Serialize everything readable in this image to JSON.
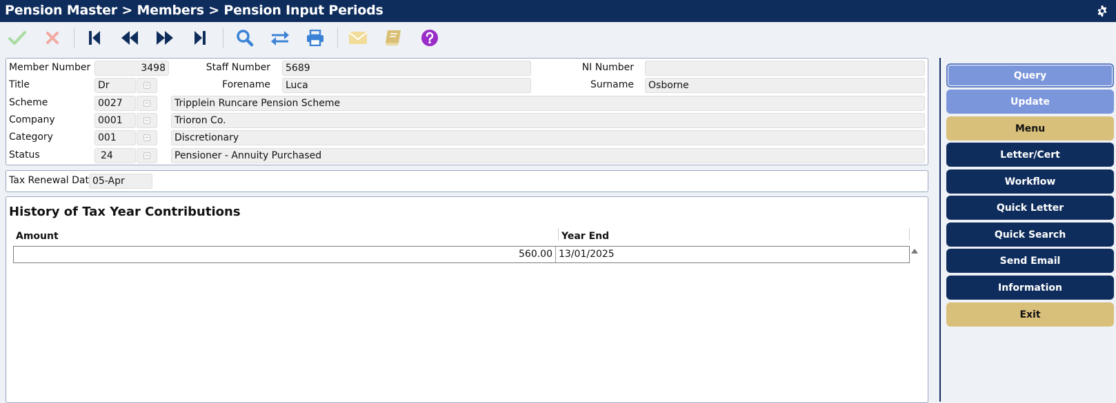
{
  "header": {
    "title": "Pension Master > Members > Pension Input Periods",
    "settings_icon": "gear-icon"
  },
  "toolbar": {
    "icons": {
      "accept": "check-icon",
      "cancel": "close-icon",
      "first": "first-record-icon",
      "previous": "previous-record-icon",
      "next": "next-record-icon",
      "last": "last-record-icon",
      "search": "search-icon",
      "swap": "swap-icon",
      "print": "print-icon",
      "email": "envelope-icon",
      "notes": "book-icon",
      "help": "help-icon"
    },
    "colors": {
      "accept": "#a8dba0",
      "cancel": "#f4a9a3",
      "nav": "#0f2d5c",
      "search": "#3b82d6",
      "email": "#f2dc9a",
      "notes": "#d9bf73",
      "help": "#9a2cc8"
    }
  },
  "member": {
    "member_number_label": "Member Number",
    "member_number": "3498",
    "staff_number_label": "Staff Number",
    "staff_number": "5689",
    "ni_number_label": "NI Number",
    "ni_number": "",
    "title_label": "Title",
    "title": "Dr",
    "forename_label": "Forename",
    "forename": "Luca",
    "surname_label": "Surname",
    "surname": "Osborne",
    "scheme_label": "Scheme",
    "scheme_code": "0027",
    "scheme_name": "Tripplein Runcare Pension Scheme",
    "company_label": "Company",
    "company_code": "0001",
    "company_name": "Trioron Co.",
    "category_label": "Category",
    "category_code": "001",
    "category_name": "Discretionary",
    "status_label": "Status",
    "status_code": "24",
    "status_name": "Pensioner - Annuity Purchased"
  },
  "tax": {
    "renewal_label": "Tax Renewal Date",
    "renewal_date": "05-Apr"
  },
  "history": {
    "title": "History of Tax Year Contributions",
    "columns": [
      "Amount",
      "Year End"
    ],
    "rows": [
      {
        "amount": "560.00",
        "year_end": "13/01/2025"
      }
    ]
  },
  "sidebar": {
    "buttons": [
      "Query",
      "Update",
      "Menu",
      "Letter/Cert",
      "Workflow",
      "Quick Letter",
      "Quick Search",
      "Send Email",
      "Information",
      "Exit"
    ],
    "colors": {
      "primary": "#7b96da",
      "menu": "#d8bf7a",
      "navy": "#0f2d5c"
    }
  }
}
